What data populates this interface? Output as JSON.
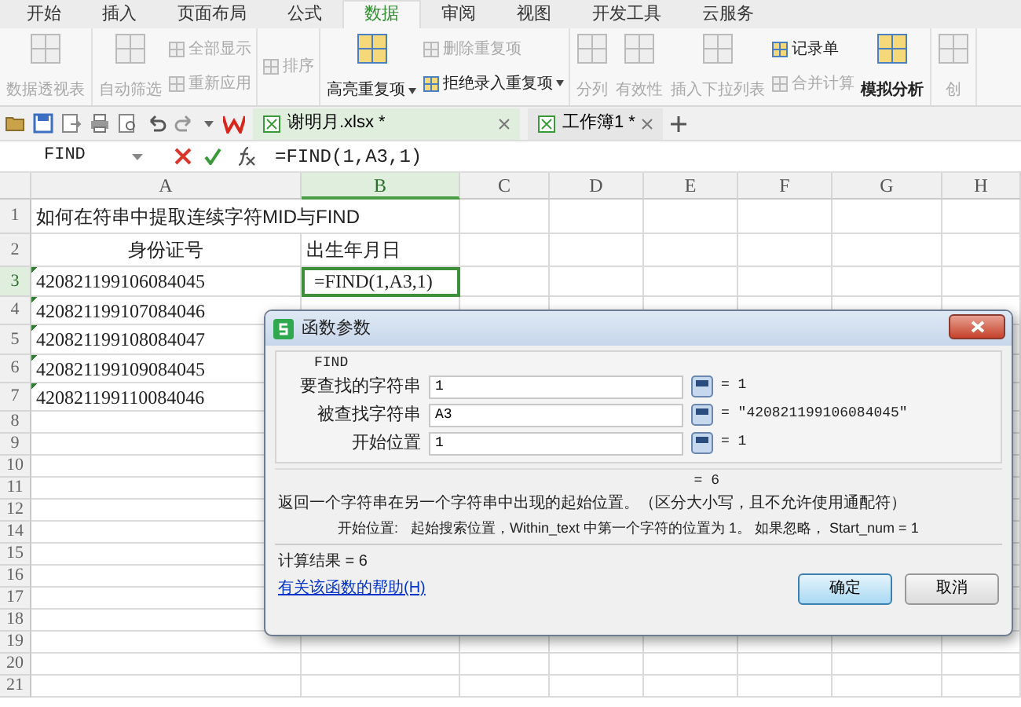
{
  "menu_tabs": [
    {
      "label": "开始",
      "selected": false
    },
    {
      "label": "插入",
      "selected": false
    },
    {
      "label": "页面布局",
      "selected": false
    },
    {
      "label": "公式",
      "selected": false
    },
    {
      "label": "数据",
      "selected": true
    },
    {
      "label": "审阅",
      "selected": false
    },
    {
      "label": "视图",
      "selected": false
    },
    {
      "label": "开发工具",
      "selected": false
    },
    {
      "label": "云服务",
      "selected": false
    }
  ],
  "ribbon": [
    {
      "items": [
        {
          "kind": "large",
          "label": "数据透视表",
          "disabled": true,
          "dropdown": false
        }
      ]
    },
    {
      "items": [
        {
          "kind": "large",
          "label": "自动筛选",
          "disabled": true,
          "dropdown": false
        },
        {
          "kind": "small",
          "label": "全部显示",
          "disabled": true,
          "dropdown": false
        },
        {
          "kind": "small",
          "label": "重新应用",
          "disabled": true,
          "dropdown": false
        }
      ]
    },
    {
      "items": [
        {
          "kind": "small",
          "label": "排序",
          "disabled": true,
          "dropdown": false
        }
      ]
    },
    {
      "items": [
        {
          "kind": "large",
          "label": "高亮重复项",
          "disabled": false,
          "dropdown": true
        },
        {
          "kind": "small",
          "label": "删除重复项",
          "disabled": true,
          "dropdown": false
        },
        {
          "kind": "small",
          "label": "拒绝录入重复项",
          "disabled": false,
          "dropdown": true
        }
      ]
    },
    {
      "items": [
        {
          "kind": "large",
          "label": "分列",
          "disabled": true,
          "dropdown": false
        },
        {
          "kind": "large",
          "label": "有效性",
          "disabled": true,
          "dropdown": false
        },
        {
          "kind": "large",
          "label": "插入下拉列表",
          "disabled": true,
          "dropdown": false
        },
        {
          "kind": "small",
          "label": "记录单",
          "disabled": false,
          "dropdown": false
        },
        {
          "kind": "small",
          "label": "合并计算",
          "disabled": true,
          "dropdown": false
        },
        {
          "kind": "large",
          "label": "模拟分析",
          "disabled": false,
          "dropdown": false
        }
      ]
    },
    {
      "items": [
        {
          "kind": "large",
          "label": "创",
          "disabled": true,
          "dropdown": false
        }
      ]
    }
  ],
  "doc_tabs": [
    {
      "label": "谢明月.xlsx *",
      "selected": true
    },
    {
      "label": "工作簿1 *",
      "selected": false
    }
  ],
  "formula_bar": {
    "name_box": "FIND",
    "formula": "=FIND(1,A3,1)"
  },
  "columns": [
    {
      "label": "A",
      "selected": false
    },
    {
      "label": "B",
      "selected": true
    },
    {
      "label": "C",
      "selected": false
    },
    {
      "label": "D",
      "selected": false
    },
    {
      "label": "E",
      "selected": false
    },
    {
      "label": "F",
      "selected": false
    },
    {
      "label": "G",
      "selected": false
    },
    {
      "label": "H",
      "selected": false
    }
  ],
  "rows": [
    {
      "num": "1",
      "selected": false,
      "active": false,
      "flag": false,
      "kind": "title",
      "cells": [
        "如何在符串中提取连续字符MID与FIND"
      ]
    },
    {
      "num": "2",
      "selected": false,
      "active": false,
      "flag": false,
      "kind": "header",
      "cells": [
        "身份证号",
        "出生年月日"
      ]
    },
    {
      "num": "3",
      "selected": true,
      "active": true,
      "flag": true,
      "kind": "data",
      "cells": [
        "420821199106084045",
        "=FIND(1,A3,1)"
      ]
    },
    {
      "num": "4",
      "selected": false,
      "active": false,
      "flag": true,
      "kind": "data",
      "cells": [
        "420821199107084046"
      ]
    },
    {
      "num": "5",
      "selected": false,
      "active": false,
      "flag": true,
      "kind": "data",
      "cells": [
        "420821199108084047"
      ]
    },
    {
      "num": "6",
      "selected": false,
      "active": false,
      "flag": true,
      "kind": "data",
      "cells": [
        "420821199109084045"
      ]
    },
    {
      "num": "7",
      "selected": false,
      "active": false,
      "flag": true,
      "kind": "data",
      "cells": [
        "420821199110084046"
      ]
    },
    {
      "num": "8",
      "selected": false,
      "active": false,
      "flag": false,
      "kind": "data",
      "cells": []
    },
    {
      "num": "9",
      "selected": false,
      "active": false,
      "flag": false,
      "kind": "data",
      "cells": []
    },
    {
      "num": "10",
      "selected": false,
      "active": false,
      "flag": false,
      "kind": "data",
      "cells": []
    },
    {
      "num": "11",
      "selected": false,
      "active": false,
      "flag": false,
      "kind": "data",
      "cells": []
    },
    {
      "num": "12",
      "selected": false,
      "active": false,
      "flag": false,
      "kind": "data",
      "cells": []
    },
    {
      "num": "14",
      "selected": false,
      "active": false,
      "flag": false,
      "kind": "data",
      "cells": []
    },
    {
      "num": "15",
      "selected": false,
      "active": false,
      "flag": false,
      "kind": "data",
      "cells": []
    },
    {
      "num": "16",
      "selected": false,
      "active": false,
      "flag": false,
      "kind": "data",
      "cells": []
    },
    {
      "num": "17",
      "selected": false,
      "active": false,
      "flag": false,
      "kind": "data",
      "cells": []
    },
    {
      "num": "18",
      "selected": false,
      "active": false,
      "flag": false,
      "kind": "data",
      "cells": []
    },
    {
      "num": "19",
      "selected": false,
      "active": false,
      "flag": false,
      "kind": "data",
      "cells": []
    },
    {
      "num": "20",
      "selected": false,
      "active": false,
      "flag": false,
      "kind": "data",
      "cells": []
    },
    {
      "num": "21",
      "selected": false,
      "active": false,
      "flag": false,
      "kind": "data",
      "cells": []
    }
  ],
  "dialog": {
    "title": "函数参数",
    "function_name": "FIND",
    "args": [
      {
        "label": "要查找的字符串",
        "value": "1",
        "result": "= 1"
      },
      {
        "label": "被查找字符串",
        "value": "A3",
        "result": "= \"420821199106084045\""
      },
      {
        "label": "开始位置",
        "value": "1",
        "result": "= 1"
      }
    ],
    "result_preview": "= 6",
    "description": "返回一个字符串在另一个字符串中出现的起始位置。（区分大小写，且不允许使用通配符）",
    "arg_help_label": "开始位置:",
    "arg_help": "起始搜索位置，Within_text 中第一个字符的位置为 1。 如果忽略， Start_num = 1",
    "calc_result": "计算结果 = 6",
    "help_link": "有关该函数的帮助(H)",
    "buttons": [
      {
        "label": "确定",
        "default": true
      },
      {
        "label": "取消",
        "default": false
      }
    ]
  }
}
